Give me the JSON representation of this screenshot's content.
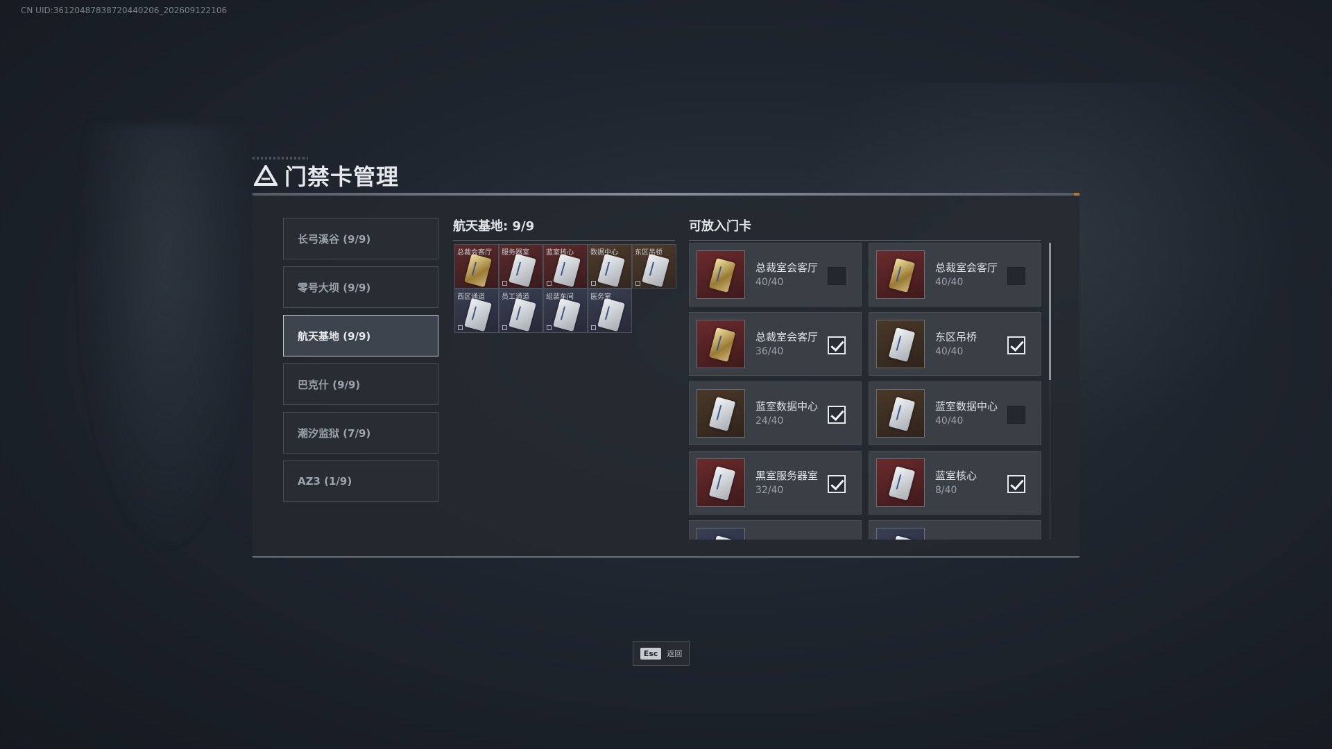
{
  "uid": "CN UID:36120487838720440206_202609122106",
  "title": "门禁卡管理",
  "nav": [
    {
      "label": "长弓溪谷 (9/9)",
      "active": false
    },
    {
      "label": "零号大坝 (9/9)",
      "active": false
    },
    {
      "label": "航天基地 (9/9)",
      "active": true
    },
    {
      "label": "巴克什 (9/9)",
      "active": false
    },
    {
      "label": "潮汐监狱 (7/9)",
      "active": false
    },
    {
      "label": "AZ3 (1/9)",
      "active": false
    }
  ],
  "middle": {
    "title": "航天基地: 9/9",
    "slots": [
      {
        "label": "总裁会客厅",
        "bg": "red",
        "gold": true
      },
      {
        "label": "服务器室",
        "bg": "red",
        "gold": false
      },
      {
        "label": "蓝室核心",
        "bg": "red",
        "gold": false
      },
      {
        "label": "数据中心",
        "bg": "brown",
        "gold": false
      },
      {
        "label": "东区吊桥",
        "bg": "brown",
        "gold": false
      },
      {
        "label": "西区通道",
        "bg": "blue",
        "gold": false
      },
      {
        "label": "员工通道",
        "bg": "blue",
        "gold": false
      },
      {
        "label": "组装车间",
        "bg": "blue",
        "gold": false
      },
      {
        "label": "医务室",
        "bg": "blue",
        "gold": false
      }
    ]
  },
  "right": {
    "title": "可放入门卡",
    "cards": [
      {
        "name": "总裁室会客厅",
        "count": "40/40",
        "checked": false,
        "bg": "red",
        "gold": true
      },
      {
        "name": "总裁室会客厅",
        "count": "40/40",
        "checked": false,
        "bg": "red",
        "gold": true
      },
      {
        "name": "总裁室会客厅",
        "count": "36/40",
        "checked": true,
        "bg": "red",
        "gold": true
      },
      {
        "name": "东区吊桥",
        "count": "40/40",
        "checked": true,
        "bg": "brown",
        "gold": false
      },
      {
        "name": "蓝室数据中心",
        "count": "24/40",
        "checked": true,
        "bg": "brown",
        "gold": false
      },
      {
        "name": "蓝室数据中心",
        "count": "40/40",
        "checked": false,
        "bg": "brown",
        "gold": false
      },
      {
        "name": "黑室服务器室",
        "count": "32/40",
        "checked": true,
        "bg": "red",
        "gold": false
      },
      {
        "name": "蓝室核心",
        "count": "8/40",
        "checked": true,
        "bg": "red",
        "gold": false
      },
      {
        "name": "",
        "count": "",
        "checked": false,
        "bg": "blue",
        "gold": false
      },
      {
        "name": "",
        "count": "",
        "checked": false,
        "bg": "blue",
        "gold": false
      }
    ]
  },
  "esc": {
    "key": "Esc",
    "label": "返回"
  },
  "colors": {
    "accent": "#b07a3a",
    "panel": "#24292f",
    "active_border": "#c9cdd2"
  }
}
